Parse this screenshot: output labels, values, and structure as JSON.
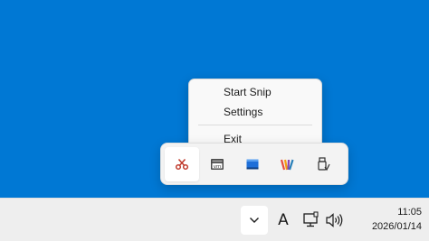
{
  "context_menu": {
    "items": [
      {
        "label": "Start Snip"
      },
      {
        "label": "Settings"
      },
      {
        "label": "Exit"
      }
    ]
  },
  "tray_flyout": {
    "icons": [
      {
        "name": "snipping-scissors-icon",
        "color": "#c0392b"
      },
      {
        "name": "vm-console-icon",
        "color": "#505050"
      },
      {
        "name": "app-window-icon",
        "color": "#1e6fd9"
      },
      {
        "name": "color-stripes-app-icon",
        "color": "#e8692b"
      },
      {
        "name": "usb-eject-icon",
        "color": "#303030"
      }
    ]
  },
  "taskbar": {
    "ime_indicator": "A",
    "clock": {
      "time": "11:05",
      "date": "2026/01/14"
    }
  },
  "colors": {
    "desktop": "#0078d4",
    "taskbar": "#eeeeee",
    "menu": "#f9f9f9"
  }
}
